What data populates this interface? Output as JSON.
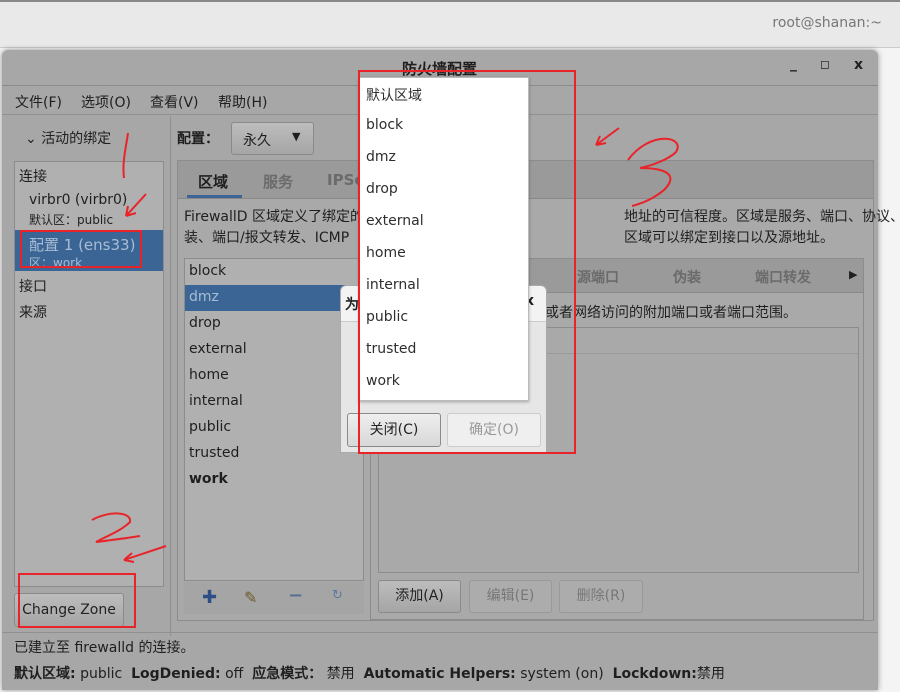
{
  "topbar": {
    "user_host": "root@shanan:~"
  },
  "window": {
    "title": "防火墙配置",
    "menu": [
      "文件(F)",
      "选项(O)",
      "查看(V)",
      "帮助(H)"
    ]
  },
  "bindings": {
    "header": "活动的绑定",
    "connections_label": "连接",
    "items": [
      {
        "name": "virbr0 (virbr0)",
        "zone": "默认区：public"
      },
      {
        "name": "配置 1 (ens33)",
        "zone": "区：work",
        "selected": true
      }
    ],
    "interfaces_label": "接口",
    "sources_label": "来源",
    "change_zone": "Change Zone"
  },
  "config": {
    "label": "配置：",
    "value": "永久"
  },
  "tabs": [
    {
      "label": "区域",
      "active": true
    },
    {
      "label": "服务"
    },
    {
      "label": "IPSets"
    }
  ],
  "description": {
    "line1_left": "FirewallD 区域定义了绑定的",
    "line1_right": "地址的可信程度。区域是服务、端口、协议、IP伪",
    "line2_left": "装、端口/报文转发、ICMP",
    "line2_right": "区域可以绑定到接口以及源地址。"
  },
  "zones": [
    "block",
    "dmz",
    "drop",
    "external",
    "home",
    "internal",
    "public",
    "trusted",
    "work"
  ],
  "selected_zone": "dmz",
  "bold_zone": "work",
  "zone_toolbar": [
    "add-icon",
    "edit-icon",
    "remove-icon",
    "reload-icon"
  ],
  "subtabs": [
    "源端口",
    "伪装",
    "端口转发"
  ],
  "ports_text": "或者网络访问的附加端口或者端口范围。",
  "port_buttons": {
    "add": "添加(A)",
    "edit": "编辑(E)",
    "remove": "删除(R)"
  },
  "dialog": {
    "title": "为",
    "close": "关闭(C)",
    "ok": "确定(O)"
  },
  "popup": {
    "items": [
      "默认区域",
      "block",
      "dmz",
      "drop",
      "external",
      "home",
      "internal",
      "public",
      "trusted",
      "work"
    ]
  },
  "status": {
    "connection": "已建立至 firewalld 的连接。",
    "default_zone_label": "默认区域:",
    "default_zone": "public",
    "logdenied_label": "LogDenied:",
    "logdenied": "off",
    "panic_label": "应急模式：",
    "panic": "禁用",
    "helpers_label": "Automatic Helpers:",
    "helpers": "system (on)",
    "lockdown_label": "Lockdown:",
    "lockdown": "禁用"
  },
  "annotations": {
    "colors": {
      "red": "#e8242a"
    },
    "numbers": [
      "2",
      "3"
    ]
  }
}
